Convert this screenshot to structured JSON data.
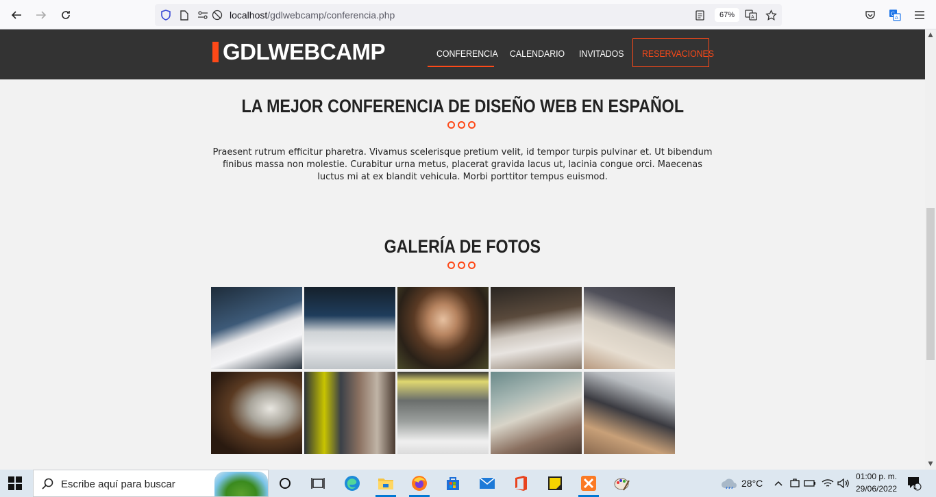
{
  "browser": {
    "url_host": "localhost",
    "url_path": "/gdlwebcamp/conferencia.php",
    "zoom": "67%"
  },
  "site": {
    "logo": "GDLWEBCAMP",
    "nav": [
      "CONFERENCIA",
      "CALENDARIO",
      "INVITADOS",
      "RESERVACIONES"
    ],
    "active_nav": "CONFERENCIA",
    "accent_color": "#fe4918",
    "header_color": "#333333"
  },
  "content": {
    "heading": "LA MEJOR CONFERENCIA DE DISEÑO WEB EN ESPAÑOL",
    "paragraph": "Praesent rutrum efficitur pharetra. Vivamus scelerisque pretium velit, id tempor turpis pulvinar et. Ut bibendum finibus massa non molestie. Curabitur urna metus, placerat gravida lacus ut, lacinia congue orci. Maecenas luctus mi at ex blandit vehicula. Morbi porttitor tempus euismod.",
    "gallery_heading": "GALERÍA DE FOTOS"
  },
  "gallery": {
    "photo_count": 10
  },
  "taskbar": {
    "search_placeholder": "Escribe aquí para buscar",
    "temperature": "28°C",
    "time": "01:00 p. m.",
    "date": "29/06/2022",
    "notification_count": "1"
  }
}
